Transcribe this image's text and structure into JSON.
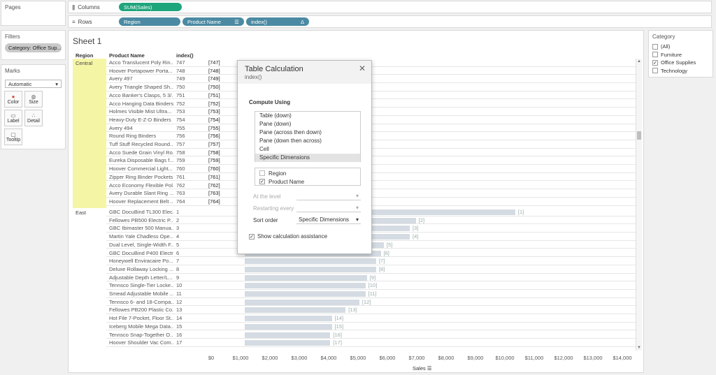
{
  "panels": {
    "pages": "Pages",
    "filters": "Filters",
    "marks": "Marks"
  },
  "filters": {
    "pill": "Category: Office Sup..."
  },
  "marks": {
    "type": "Automatic",
    "buttons": [
      "Color",
      "Size",
      "Label",
      "Detail",
      "Tooltip"
    ]
  },
  "shelves": {
    "columns_label": "Columns",
    "rows_label": "Rows",
    "columns_pill": "SUM(Sales)",
    "rows_pills": [
      "Region",
      "Product Name",
      "index()"
    ]
  },
  "sheet": {
    "title": "Sheet 1",
    "headers": {
      "region": "Region",
      "product": "Product Name",
      "index": "index()"
    }
  },
  "regions": [
    "Central",
    "East"
  ],
  "central_rows": [
    {
      "name": "Acco Translucent Poly Rin...",
      "index": "747",
      "label": "[747]"
    },
    {
      "name": "Hoover Portapower Porta...",
      "index": "748",
      "label": "[748]"
    },
    {
      "name": "Avery 497",
      "index": "749",
      "label": "[749]"
    },
    {
      "name": "Avery Triangle Shaped Sh...",
      "index": "750",
      "label": "[750]"
    },
    {
      "name": "Acco Banker's Clasps, 5 3/...",
      "index": "751",
      "label": "[751]"
    },
    {
      "name": "Acco Hanging Data Binders",
      "index": "752",
      "label": "[752]"
    },
    {
      "name": "Holmes Visible Mist Ultra...",
      "index": "753",
      "label": "[753]"
    },
    {
      "name": "Heavy-Duty E-Z-D Binders",
      "index": "754",
      "label": "[754]"
    },
    {
      "name": "Avery 494",
      "index": "755",
      "label": "[755]"
    },
    {
      "name": "Round Ring Binders",
      "index": "756",
      "label": "[756]"
    },
    {
      "name": "Tuff Stuff Recycled Round...",
      "index": "757",
      "label": "[757]"
    },
    {
      "name": "Acco Suede Grain Vinyl Ro...",
      "index": "758",
      "label": "[758]"
    },
    {
      "name": "Eureka Disposable Bags f...",
      "index": "759",
      "label": "[759]"
    },
    {
      "name": "Hoover Commercial Light...",
      "index": "760",
      "label": "[760]"
    },
    {
      "name": "Zipper Ring Binder Pockets",
      "index": "761",
      "label": "[761]"
    },
    {
      "name": "Acco Economy Flexible Pol...",
      "index": "762",
      "label": "[762]"
    },
    {
      "name": "Avery Durable Slant Ring ...",
      "index": "763",
      "label": "[763]"
    },
    {
      "name": "Hoover Replacement Belt ...",
      "index": "764",
      "label": "[764]"
    }
  ],
  "east_rows": [
    {
      "name": "GBC DocuBind TL300 Elec...",
      "index": "1",
      "label": "[1]",
      "sales": 8850
    },
    {
      "name": "Fellowes PB500 Electric P...",
      "index": "2",
      "label": "[2]",
      "sales": 5600
    },
    {
      "name": "GBC Ibimaster 500 Manua...",
      "index": "3",
      "label": "[3]",
      "sales": 5400
    },
    {
      "name": "Martin Yale Chadless Ope...",
      "index": "4",
      "label": "[4]",
      "sales": 5400
    },
    {
      "name": "Dual Level, Single-Width F...",
      "index": "5",
      "label": "[5]",
      "sales": 4550
    },
    {
      "name": "GBC DocuBind P400 Electr...",
      "index": "6",
      "label": "[6]",
      "sales": 4450
    },
    {
      "name": "Honeywell Enviracaire Po...",
      "index": "7",
      "label": "[7]",
      "sales": 4300
    },
    {
      "name": "Deluxe Rollaway Locking ...",
      "index": "8",
      "label": "[8]",
      "sales": 4300
    },
    {
      "name": "Adjustable Depth Letter/L...",
      "index": "9",
      "label": "[9]",
      "sales": 4000
    },
    {
      "name": "Tennsco Single-Tier Locke...",
      "index": "10",
      "label": "[10]",
      "sales": 3950
    },
    {
      "name": "Smead Adjustable Mobile ...",
      "index": "11",
      "label": "[11]",
      "sales": 3950
    },
    {
      "name": "Tennsco 6- and 18-Compa...",
      "index": "12",
      "label": "[12]",
      "sales": 3750
    },
    {
      "name": "Fellowes PB200 Plastic Co...",
      "index": "13",
      "label": "[13]",
      "sales": 3300
    },
    {
      "name": "Hot File 7-Pocket, Floor St...",
      "index": "14",
      "label": "[14]",
      "sales": 2850
    },
    {
      "name": "Iceberg Mobile Mega Data...",
      "index": "15",
      "label": "[15]",
      "sales": 2850
    },
    {
      "name": "Tennsco Snap-Together O...",
      "index": "16",
      "label": "[16]",
      "sales": 2800
    },
    {
      "name": "Hoover Shoulder Vac Com...",
      "index": "17",
      "label": "[17]",
      "sales": 2800
    }
  ],
  "axis": {
    "title": "Sales",
    "max": 14000,
    "ticks": [
      "$0",
      "$1,000",
      "$2,000",
      "$3,000",
      "$4,000",
      "$5,000",
      "$6,000",
      "$7,000",
      "$8,000",
      "$9,000",
      "$10,000",
      "$11,000",
      "$12,000",
      "$13,000",
      "$14,000"
    ]
  },
  "category": {
    "title": "Category",
    "items": [
      {
        "label": "(All)",
        "checked": false
      },
      {
        "label": "Furniture",
        "checked": false
      },
      {
        "label": "Office Supplies",
        "checked": true
      },
      {
        "label": "Technology",
        "checked": false
      }
    ]
  },
  "dialog": {
    "title": "Table Calculation",
    "subtitle": "index()",
    "compute_label": "Compute Using",
    "compute_options": [
      "Table (down)",
      "Pane (down)",
      "Pane (across then down)",
      "Pane (down then across)",
      "Cell",
      "Specific Dimensions"
    ],
    "selected_option": 5,
    "dimensions": [
      {
        "label": "Region",
        "checked": false
      },
      {
        "label": "Product Name",
        "checked": true
      }
    ],
    "at_level_label": "At the level",
    "restarting_label": "Restarting every",
    "sort_order_label": "Sort order",
    "sort_order_value": "Specific Dimensions",
    "show_assist_label": "Show calculation assistance",
    "show_assist_checked": true
  },
  "colors": {
    "green_pill": "#1fa57c",
    "blue_pill": "#4b8aa2",
    "highlight": "#f5f5a6",
    "bar": "#d4dbe2"
  }
}
